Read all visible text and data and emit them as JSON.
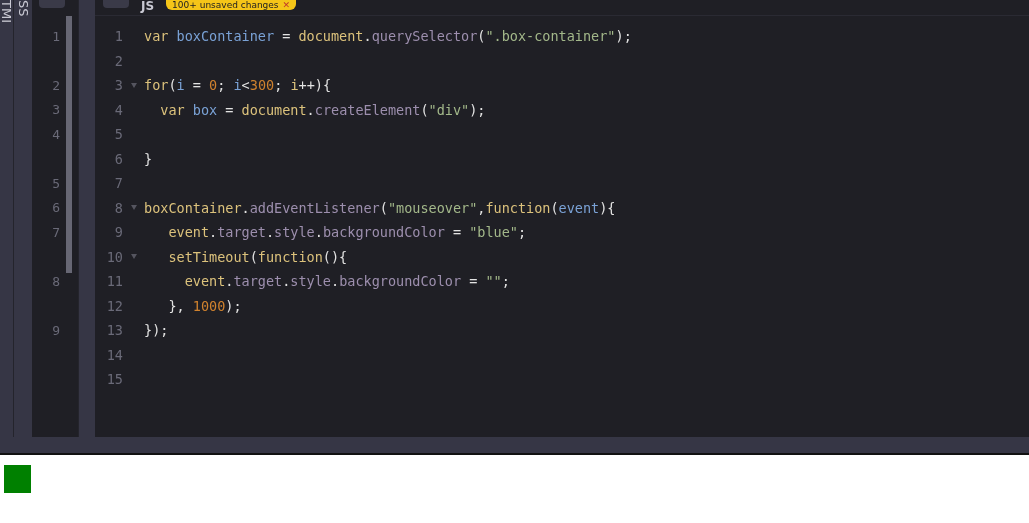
{
  "side_tabs": [
    {
      "label": "TMI"
    },
    {
      "label": "SS"
    }
  ],
  "header": {
    "js_label": "JS",
    "badge": "100+ unsaved changes",
    "badge_close": "✕"
  },
  "css_gutter": [
    {
      "number": "1",
      "wrapped": true
    },
    {
      "number": "2",
      "wrapped": false
    },
    {
      "number": "3",
      "wrapped": false
    },
    {
      "number": "4",
      "wrapped": true
    },
    {
      "number": "5",
      "wrapped": false
    },
    {
      "number": "6",
      "wrapped": false
    },
    {
      "number": "7",
      "wrapped": true
    },
    {
      "number": "8",
      "wrapped": true
    },
    {
      "number": "9",
      "wrapped": false
    }
  ],
  "js_editor": {
    "lines": [
      {
        "number": "1",
        "foldable": false,
        "text": "var boxContainer = document.querySelector(\".box-container\");"
      },
      {
        "number": "2",
        "foldable": false
      },
      {
        "number": "3",
        "foldable": true,
        "text": "for(i = 0; i<300; i++){"
      },
      {
        "number": "4",
        "foldable": false,
        "text": "  var box = document.createElement(\"div\");"
      },
      {
        "number": "5",
        "foldable": false
      },
      {
        "number": "6",
        "foldable": false,
        "text": "}"
      },
      {
        "number": "7",
        "foldable": false
      },
      {
        "number": "8",
        "foldable": true,
        "text": "boxContainer.addEventListener(\"mouseover\",function(event){"
      },
      {
        "number": "9",
        "foldable": false,
        "text": "   event.target.style.backgroundColor = \"blue\";"
      },
      {
        "number": "10",
        "foldable": true,
        "text": "   setTimeout(function(){"
      },
      {
        "number": "11",
        "foldable": false,
        "text": "     event.target.style.backgroundColor = \"\";"
      },
      {
        "number": "12",
        "foldable": false,
        "text": "   }, 1000);"
      },
      {
        "number": "13",
        "foldable": false,
        "text": "});"
      },
      {
        "number": "14",
        "foldable": false
      },
      {
        "number": "15",
        "foldable": false
      }
    ]
  }
}
